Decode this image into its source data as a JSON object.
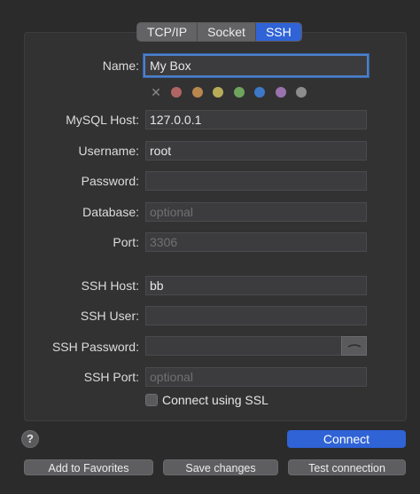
{
  "tabs": [
    {
      "label": "TCP/IP",
      "active": false
    },
    {
      "label": "Socket",
      "active": false
    },
    {
      "label": "SSH",
      "active": true
    }
  ],
  "form": {
    "name": {
      "label": "Name:",
      "value": "My Box"
    },
    "mysql_host": {
      "label": "MySQL Host:",
      "value": "127.0.0.1"
    },
    "username": {
      "label": "Username:",
      "value": "root"
    },
    "password": {
      "label": "Password:",
      "value": ""
    },
    "database": {
      "label": "Database:",
      "value": "",
      "placeholder": "optional"
    },
    "port": {
      "label": "Port:",
      "value": "",
      "placeholder": "3306"
    },
    "ssh_host": {
      "label": "SSH Host:",
      "value": "bb"
    },
    "ssh_user": {
      "label": "SSH User:",
      "value": ""
    },
    "ssh_password": {
      "label": "SSH Password:",
      "value": ""
    },
    "ssh_port": {
      "label": "SSH Port:",
      "value": "",
      "placeholder": "optional"
    },
    "ssl": {
      "label": "Connect using SSL",
      "checked": false
    }
  },
  "color_tags": [
    {
      "name": "red",
      "hex": "#b06565"
    },
    {
      "name": "orange",
      "hex": "#b8874d"
    },
    {
      "name": "yellow",
      "hex": "#b9ac58"
    },
    {
      "name": "green",
      "hex": "#6fa35e"
    },
    {
      "name": "blue",
      "hex": "#3d78c8"
    },
    {
      "name": "purple",
      "hex": "#9a72ad"
    },
    {
      "name": "gray",
      "hex": "#8d8d8d"
    }
  ],
  "buttons": {
    "help": "?",
    "connect": "Connect",
    "add_to_favorites": "Add to Favorites",
    "save_changes": "Save changes",
    "test_connection": "Test connection"
  },
  "colors": {
    "accent": "#2f63d6",
    "focus_ring": "#4d80c9"
  }
}
